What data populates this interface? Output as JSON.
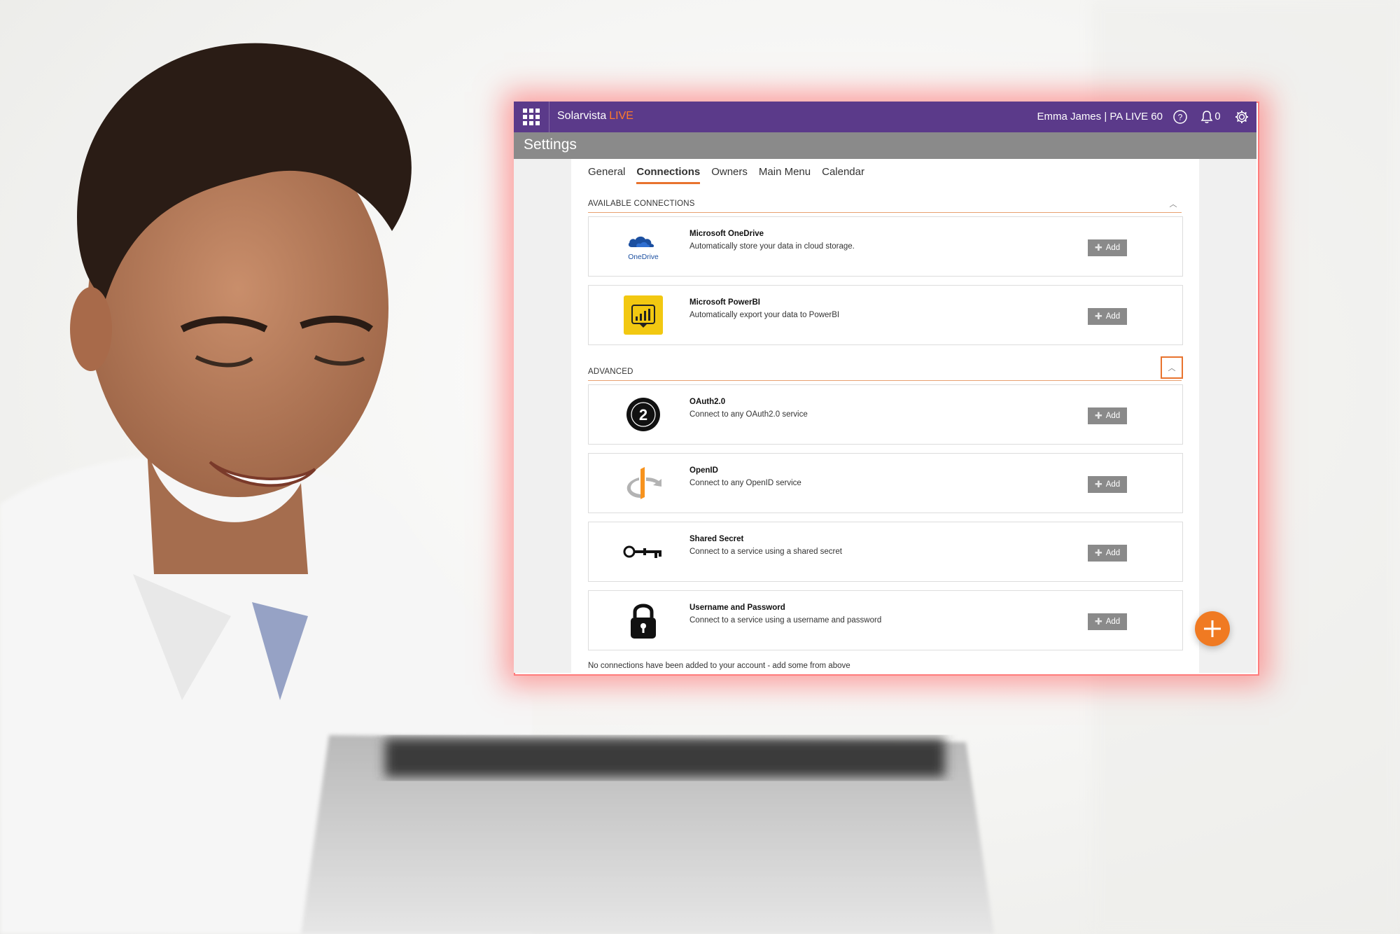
{
  "app": {
    "brand_name": "Solarvista",
    "brand_suffix": "LIVE",
    "user_label": "Emma James  |  PA LIVE 60",
    "notification_count": "0",
    "accent_color": "#5b3a8a",
    "highlight_color": "#e8732e"
  },
  "page": {
    "title": "Settings"
  },
  "tabs": [
    {
      "label": "General",
      "active": false
    },
    {
      "label": "Connections",
      "active": true
    },
    {
      "label": "Owners",
      "active": false
    },
    {
      "label": "Main Menu",
      "active": false
    },
    {
      "label": "Calendar",
      "active": false
    }
  ],
  "sections": {
    "available": {
      "label": "AVAILABLE CONNECTIONS",
      "items": [
        {
          "name": "Microsoft OneDrive",
          "description": "Automatically store your data in cloud storage.",
          "icon": "onedrive-icon",
          "logo_text": "OneDrive",
          "button": "Add"
        },
        {
          "name": "Microsoft PowerBI",
          "description": "Automatically export your data to PowerBI",
          "icon": "powerbi-icon",
          "button": "Add"
        }
      ]
    },
    "advanced": {
      "label": "ADVANCED",
      "items": [
        {
          "name": "OAuth2.0",
          "description": "Connect to any OAuth2.0 service",
          "icon": "oauth2-icon",
          "logo_text": "2",
          "button": "Add"
        },
        {
          "name": "OpenID",
          "description": "Connect to any OpenID service",
          "icon": "openid-icon",
          "button": "Add"
        },
        {
          "name": "Shared Secret",
          "description": "Connect to a service using a shared secret",
          "icon": "key-icon",
          "button": "Add"
        },
        {
          "name": "Username and Password",
          "description": "Connect to a service using a username and password",
          "icon": "lock-icon",
          "button": "Add"
        }
      ]
    }
  },
  "empty_message": "No connections have been added to your account - add some from above"
}
